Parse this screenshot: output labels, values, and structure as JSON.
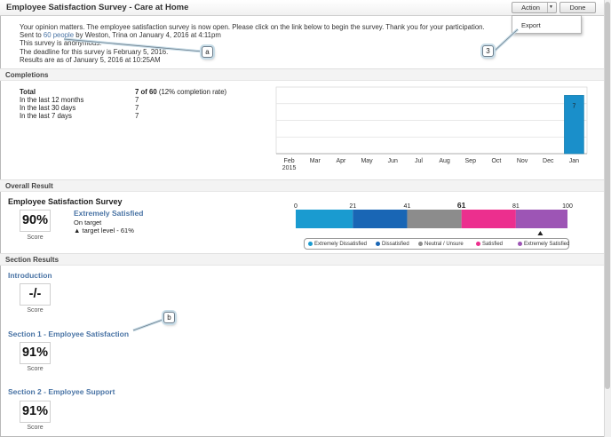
{
  "header": {
    "title": "Employee Satisfaction Survey - Care at Home",
    "action_label": "Action",
    "done_label": "Done"
  },
  "action_menu": {
    "items": [
      "Export"
    ]
  },
  "intro": {
    "line1": "Your opinion matters. The employee satisfaction survey is now open. Please click on the link below to begin the survey. Thank you for your participation.",
    "line2_prefix": "Sent to ",
    "line2_link": "60 people",
    "line2_suffix": " by Weston, Trina on January 4, 2016 at 4:11pm",
    "line3": "This survey is anonymous.",
    "line4": "The deadline for this survey is February 5, 2016.",
    "line5": "Results are as of January 5, 2016 at 10:25AM"
  },
  "completions": {
    "section_label": "Completions",
    "rows": [
      {
        "label": "Total",
        "value": "7 of 60",
        "note": "(12% completion rate)"
      },
      {
        "label": "In the last 12 months",
        "value": "7",
        "note": ""
      },
      {
        "label": "In the last 30 days",
        "value": "7",
        "note": ""
      },
      {
        "label": "In the last 7 days",
        "value": "7",
        "note": ""
      }
    ]
  },
  "chart_data": {
    "type": "bar",
    "categories": [
      "Feb\n2015",
      "Mar",
      "Apr",
      "May",
      "Jun",
      "Jul",
      "Aug",
      "Sep",
      "Oct",
      "Nov",
      "Dec",
      "Jan"
    ],
    "values": [
      0,
      0,
      0,
      0,
      0,
      0,
      0,
      0,
      0,
      0,
      0,
      7
    ],
    "data_labels": [
      "",
      "",
      "",
      "",
      "",
      "",
      "",
      "",
      "",
      "",
      "",
      "7"
    ],
    "title": "",
    "xlabel": "",
    "ylabel": "",
    "ylim": [
      0,
      8
    ],
    "grid": true,
    "bar_color": "#1a8fca"
  },
  "overall": {
    "section_label": "Overall Result",
    "survey_title": "Employee Satisfaction Survey",
    "score": "90%",
    "score_label": "Score",
    "level": "Extremely Satisfied",
    "status": "On target",
    "target": "target level - 61%",
    "scale": {
      "ticks": [
        0,
        21,
        41,
        61,
        81,
        100
      ],
      "highlight": 61,
      "bands": [
        {
          "from": 0,
          "to": 21,
          "color": "#1a9bd0"
        },
        {
          "from": 21,
          "to": 41,
          "color": "#1966b5"
        },
        {
          "from": 41,
          "to": 61,
          "color": "#8c8c8c"
        },
        {
          "from": 61,
          "to": 81,
          "color": "#ec2f8e"
        },
        {
          "from": 81,
          "to": 100,
          "color": "#9d55b5"
        }
      ]
    },
    "legend": [
      {
        "label": "Extremely Dissatisfied",
        "color": "#1a9bd0"
      },
      {
        "label": "Dissatisfied",
        "color": "#1966b5"
      },
      {
        "label": "Neutral / Unsure",
        "color": "#8c8c8c"
      },
      {
        "label": "Satisfied",
        "color": "#ec2f8e"
      },
      {
        "label": "Extremely Satisfied",
        "color": "#9d55b5"
      }
    ]
  },
  "sections": {
    "section_label": "Section Results",
    "items": [
      {
        "title": "Introduction",
        "score": "-/-",
        "score_label": "Score"
      },
      {
        "title": "Section 1 - Employee Satisfaction",
        "score": "91%",
        "score_label": "Score"
      },
      {
        "title": "Section 2 - Employee Support",
        "score": "91%",
        "score_label": "Score"
      }
    ]
  },
  "callouts": [
    "a",
    "3",
    "b"
  ]
}
